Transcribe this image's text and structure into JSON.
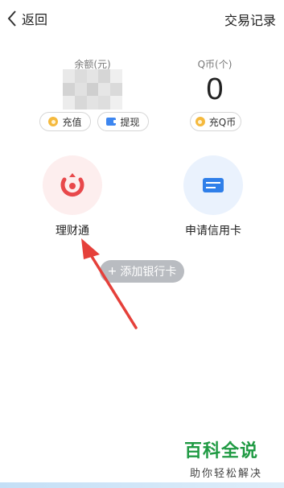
{
  "header": {
    "back_label": "返回",
    "records_label": "交易记录"
  },
  "balance": {
    "label": "余额(元)"
  },
  "qcoin": {
    "label": "Q币(个)",
    "value": "0"
  },
  "actions": {
    "recharge": "充值",
    "withdraw": "提现",
    "recharge_qcoin": "充Q币"
  },
  "services": [
    {
      "label": "理财通"
    },
    {
      "label": "申请信用卡"
    }
  ],
  "add_bank_card": "添加银行卡",
  "watermark": {
    "title": "百科全说",
    "subtitle": "助你轻松解决"
  },
  "colors": {
    "coin": "#f5b93d",
    "wallet_blue": "#3d86f0",
    "licai_red": "#e8484b",
    "credit_blue": "#2f7fe9",
    "arrow_red": "#e5403a",
    "watermark_green": "#1f9a43"
  }
}
